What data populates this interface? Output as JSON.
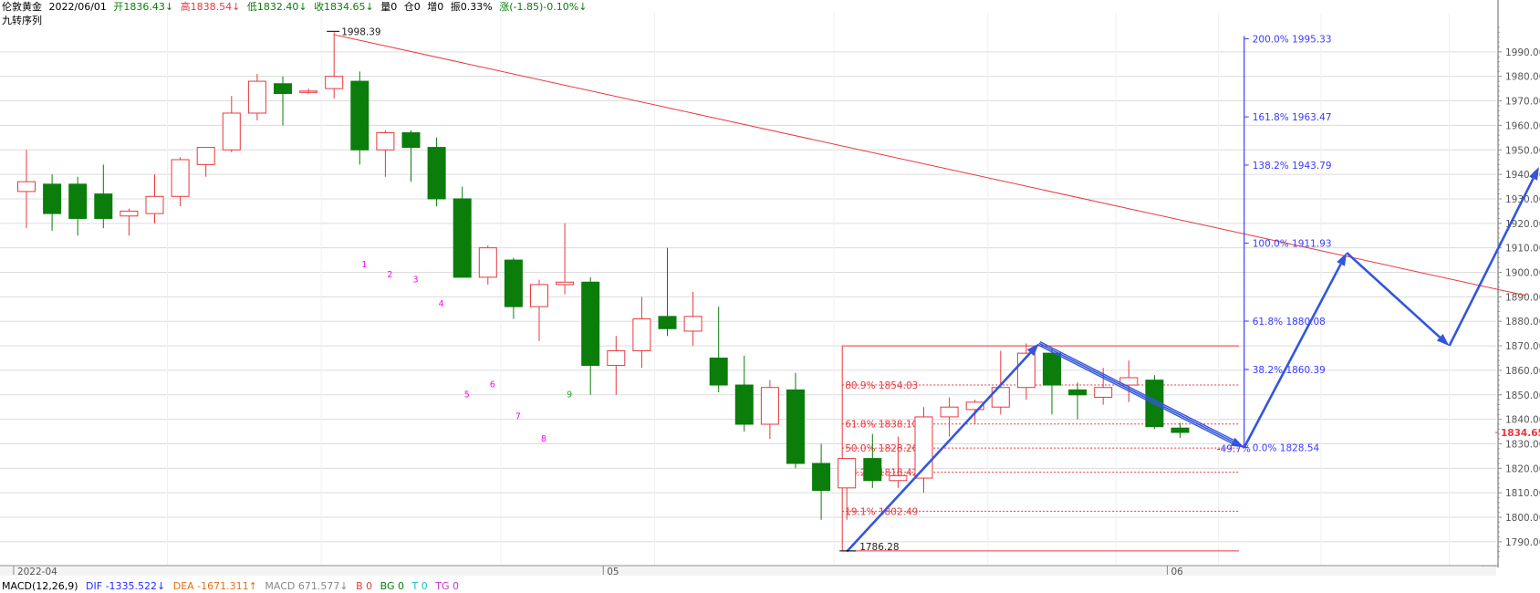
{
  "header": {
    "instrument": "伦敦黄金",
    "date": "2022/06/01",
    "open": "开1836.43↓",
    "high": "高1838.54↓",
    "low": "低1832.40↓",
    "close": "收1834.65↓",
    "volume": "量0",
    "position_change": "仓0",
    "increase": "增0",
    "amplitude": "振0.33%",
    "change": "涨(-1.85)-0.10%↓",
    "indicator_name": "九转序列"
  },
  "macd": {
    "name": "MACD(12,26,9)",
    "dif": "DIF -1335.522↓",
    "dea": "DEA -1671.311↑",
    "macd": "MACD 671.577↓",
    "b": "B 0",
    "bg": "BG 0",
    "t": "T 0",
    "tg": "TG 0"
  },
  "colors": {
    "up": "#e8383d",
    "down": "#0a7d0a",
    "fib_axis": "#3a3aff",
    "trend": "#e8383d",
    "arrow": "#3355dd",
    "seq_up": "#ff00ff",
    "seq_green": "#22aa22"
  },
  "chart_data": {
    "type": "candlestick",
    "ylim": [
      1784,
      2000
    ],
    "y_ticks": [
      1790,
      1800,
      1810,
      1820,
      1830,
      1840,
      1850,
      1860,
      1870,
      1880,
      1890,
      1900,
      1910,
      1920,
      1930,
      1940,
      1950,
      1960,
      1970,
      1980,
      1990
    ],
    "x_labels": [
      {
        "label": "2022-04",
        "index": 0
      },
      {
        "label": "05",
        "index": 23
      },
      {
        "label": "06",
        "index": 45
      }
    ],
    "candles": [
      [
        1933,
        1950,
        1918,
        1937
      ],
      [
        1936,
        1940,
        1917,
        1924
      ],
      [
        1936,
        1939,
        1915,
        1922
      ],
      [
        1932,
        1944,
        1918,
        1922
      ],
      [
        1923,
        1926,
        1915,
        1925
      ],
      [
        1924,
        1940,
        1920,
        1931
      ],
      [
        1931,
        1947,
        1927,
        1946
      ],
      [
        1944,
        1951,
        1939,
        1951
      ],
      [
        1950,
        1972,
        1949,
        1965
      ],
      [
        1965,
        1981,
        1962,
        1978
      ],
      [
        1977,
        1980,
        1960,
        1973
      ],
      [
        1974,
        1975,
        1973,
        1974
      ],
      [
        1975,
        1998,
        1971,
        1980
      ],
      [
        1978,
        1982,
        1944,
        1950
      ],
      [
        1950,
        1958,
        1939,
        1957
      ],
      [
        1957,
        1958,
        1937,
        1951
      ],
      [
        1951,
        1955,
        1927,
        1930
      ],
      [
        1930,
        1935,
        1911,
        1898
      ],
      [
        1898,
        1911,
        1895,
        1910
      ],
      [
        1905,
        1906,
        1881,
        1886
      ],
      [
        1886,
        1897,
        1872,
        1895
      ],
      [
        1895,
        1920,
        1891,
        1896
      ],
      [
        1896,
        1898,
        1850,
        1862
      ],
      [
        1862,
        1874,
        1850,
        1868
      ],
      [
        1868,
        1890,
        1861,
        1881
      ],
      [
        1882,
        1910,
        1874,
        1877
      ],
      [
        1876,
        1892,
        1870,
        1882
      ],
      [
        1865,
        1886,
        1851,
        1854
      ],
      [
        1854,
        1866,
        1835,
        1838
      ],
      [
        1838,
        1856,
        1832,
        1853
      ],
      [
        1852,
        1859,
        1820,
        1822
      ],
      [
        1822,
        1830,
        1799,
        1811
      ],
      [
        1812,
        1824,
        1799,
        1824
      ],
      [
        1824,
        1834,
        1812,
        1815
      ],
      [
        1815,
        1833,
        1812,
        1817
      ],
      [
        1816,
        1845,
        1810,
        1841
      ],
      [
        1841,
        1849,
        1833,
        1845
      ],
      [
        1844,
        1848,
        1838,
        1847
      ],
      [
        1845,
        1868,
        1842,
        1853
      ],
      [
        1853,
        1871,
        1848,
        1867
      ],
      [
        1867,
        1869,
        1842,
        1854
      ],
      [
        1852,
        1855,
        1840,
        1850
      ],
      [
        1849,
        1861,
        1846,
        1853
      ],
      [
        1854,
        1864,
        1847,
        1857
      ],
      [
        1856,
        1858,
        1836,
        1837
      ],
      [
        1836.43,
        1838.54,
        1832.4,
        1834.65
      ]
    ],
    "seq_labels": [
      {
        "text": "1",
        "index": 13,
        "color": "magenta",
        "y": 1902
      },
      {
        "text": "2",
        "index": 14,
        "color": "magenta",
        "y": 1898
      },
      {
        "text": "3",
        "index": 15,
        "color": "magenta",
        "y": 1896
      },
      {
        "text": "4",
        "index": 16,
        "color": "magenta",
        "y": 1886
      },
      {
        "text": "5",
        "index": 17,
        "color": "magenta",
        "y": 1849
      },
      {
        "text": "6",
        "index": 18,
        "color": "magenta",
        "y": 1853
      },
      {
        "text": "7",
        "index": 19,
        "color": "magenta",
        "y": 1840
      },
      {
        "text": "8",
        "index": 20,
        "color": "magenta",
        "y": 1831
      },
      {
        "text": "9",
        "index": 21,
        "color": "green",
        "y": 1849
      }
    ],
    "annotations": {
      "high_label": "1998.39",
      "high_value": 1998.39,
      "low_label": "1786.28",
      "low_value": 1786.28,
      "current_price": "1834.65",
      "current_value": 1834.65,
      "pct_label": "-49.7%"
    },
    "fib_retracement": [
      {
        "label": "80.9% 1854.03",
        "value": 1854.03
      },
      {
        "label": "61.8% 1838.10",
        "value": 1838.1
      },
      {
        "label": "50.0% 1828.26",
        "value": 1828.26
      },
      {
        "label": "38.2% 1818.42",
        "value": 1818.42
      },
      {
        "label": "19.1% 1802.49",
        "value": 1802.49
      }
    ],
    "fib_box": {
      "top": 1870,
      "bottom": 1786.28
    },
    "fib_extension": [
      {
        "label": "200.0% 1995.33",
        "value": 1995.33
      },
      {
        "label": "161.8% 1963.47",
        "value": 1963.47
      },
      {
        "label": "138.2% 1943.79",
        "value": 1943.79
      },
      {
        "label": "100.0% 1911.93",
        "value": 1911.93
      },
      {
        "label": "61.8% 1880.08",
        "value": 1880.08
      },
      {
        "label": "38.2% 1860.39",
        "value": 1860.39
      },
      {
        "label": "0.0% 1828.54",
        "value": 1828.54
      }
    ],
    "trendline": [
      {
        "index": 12,
        "value": 1997
      },
      {
        "index": 58.5,
        "value": 1890.5
      }
    ],
    "arrows": [
      {
        "from": [
          32,
          1786
        ],
        "to": [
          39.5,
          1871
        ],
        "double": false
      },
      {
        "from": [
          39.5,
          1871
        ],
        "to": [
          47.5,
          1828.5
        ],
        "double": true
      },
      {
        "from": [
          47.5,
          1828.5
        ],
        "to": [
          51.5,
          1908
        ],
        "double": false
      },
      {
        "from": [
          51.5,
          1908
        ],
        "to": [
          55.5,
          1870
        ],
        "double": false
      },
      {
        "from": [
          55.5,
          1870
        ],
        "to": [
          59,
          1943
        ],
        "double": false
      }
    ],
    "day_separators": [
      6,
      12,
      19,
      25,
      32,
      38,
      43,
      47,
      51,
      56
    ]
  }
}
